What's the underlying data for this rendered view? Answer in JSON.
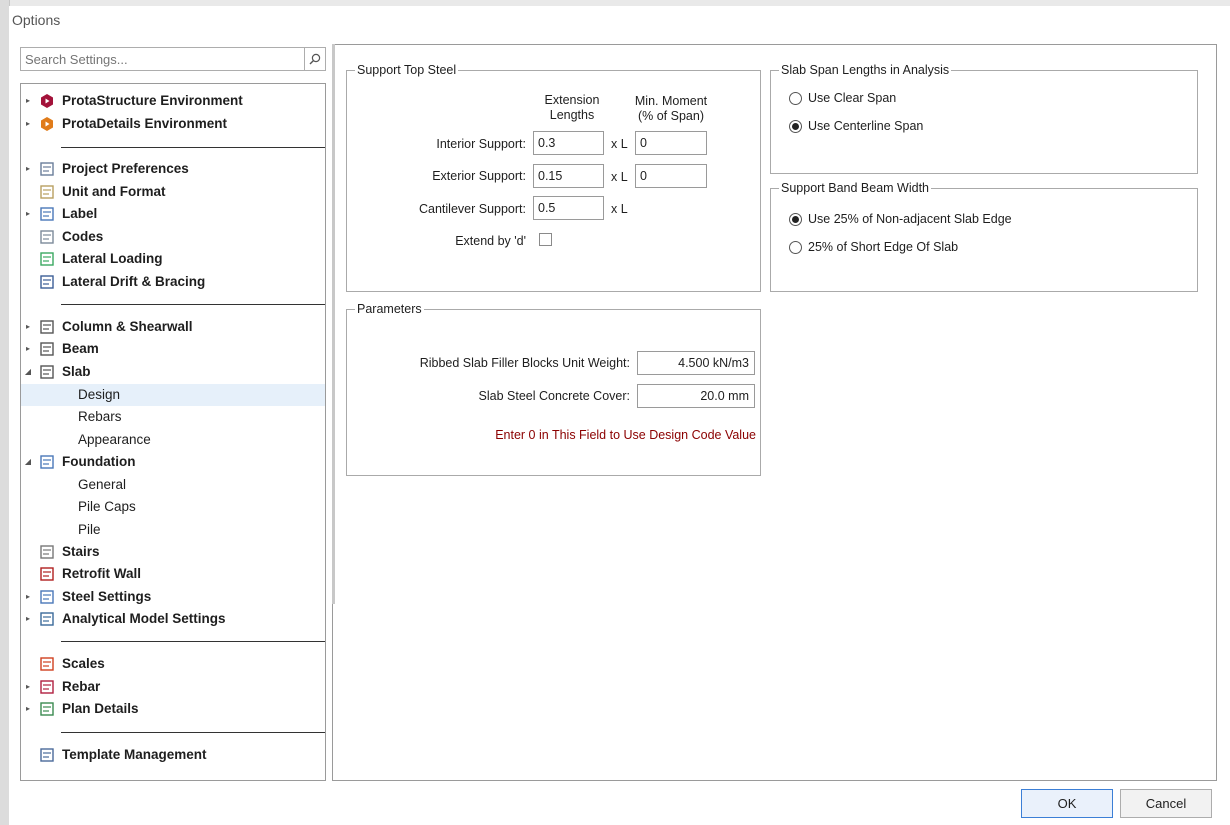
{
  "window": {
    "title": "Options"
  },
  "search": {
    "placeholder": "Search Settings..."
  },
  "tree": [
    {
      "label": "ProtaStructure Environment",
      "bold": true,
      "arrow": "▸",
      "icon": "protastructure-icon"
    },
    {
      "label": "ProtaDetails Environment",
      "bold": true,
      "arrow": "▸",
      "icon": "protadetails-icon"
    },
    {
      "label": "Project Preferences",
      "bold": true,
      "arrow": "▸",
      "icon": "preferences-icon"
    },
    {
      "label": "Unit and Format",
      "bold": true,
      "arrow": "",
      "icon": "unit-format-icon"
    },
    {
      "label": "Label",
      "bold": true,
      "arrow": "▸",
      "icon": "label-icon"
    },
    {
      "label": "Codes",
      "bold": true,
      "arrow": "",
      "icon": "codes-icon"
    },
    {
      "label": "Lateral Loading",
      "bold": true,
      "arrow": "",
      "icon": "lateral-loading-icon"
    },
    {
      "label": "Lateral Drift & Bracing",
      "bold": true,
      "arrow": "",
      "icon": "lateral-drift-icon"
    },
    {
      "label": "Column & Shearwall",
      "bold": true,
      "arrow": "▸",
      "icon": "column-icon"
    },
    {
      "label": "Beam",
      "bold": true,
      "arrow": "▸",
      "icon": "beam-icon"
    },
    {
      "label": "Slab",
      "bold": true,
      "arrow": "◢",
      "icon": "slab-icon"
    },
    {
      "label": "Design",
      "bold": false,
      "selected": true
    },
    {
      "label": "Rebars",
      "bold": false
    },
    {
      "label": "Appearance",
      "bold": false
    },
    {
      "label": "Foundation",
      "bold": true,
      "arrow": "◢",
      "icon": "foundation-icon"
    },
    {
      "label": "General",
      "bold": false
    },
    {
      "label": "Pile Caps",
      "bold": false
    },
    {
      "label": "Pile",
      "bold": false
    },
    {
      "label": "Stairs",
      "bold": true,
      "arrow": "",
      "icon": "stairs-icon"
    },
    {
      "label": "Retrofit Wall",
      "bold": true,
      "arrow": "",
      "icon": "retrofit-wall-icon"
    },
    {
      "label": "Steel Settings",
      "bold": true,
      "arrow": "▸",
      "icon": "steel-icon"
    },
    {
      "label": "Analytical Model Settings",
      "bold": true,
      "arrow": "▸",
      "icon": "analytical-model-icon"
    },
    {
      "label": "Scales",
      "bold": true,
      "arrow": "",
      "icon": "scales-icon"
    },
    {
      "label": "Rebar",
      "bold": true,
      "arrow": "▸",
      "icon": "rebar-icon"
    },
    {
      "label": "Plan Details",
      "bold": true,
      "arrow": "▸",
      "icon": "plan-details-icon"
    },
    {
      "label": "Template Management",
      "bold": true,
      "arrow": "",
      "icon": "template-icon"
    }
  ],
  "support_top_steel": {
    "legend": "Support Top Steel",
    "col1_header_line1": "Extension",
    "col1_header_line2": "Lengths",
    "col2_header_line1": "Min. Moment",
    "col2_header_line2": "(% of Span)",
    "rows": [
      {
        "label": "Interior Support:",
        "extension": "0.3",
        "unit": "x L",
        "min_moment": "0"
      },
      {
        "label": "Exterior Support:",
        "extension": "0.15",
        "unit": "x L",
        "min_moment": "0"
      },
      {
        "label": "Cantilever Support:",
        "extension": "0.5",
        "unit": "x L"
      }
    ],
    "extend_label": "Extend by 'd'",
    "extend_checked": false
  },
  "slab_span": {
    "legend": "Slab Span Lengths in Analysis",
    "options": [
      "Use Clear Span",
      "Use Centerline Span"
    ],
    "selected": "Use Centerline Span"
  },
  "band_beam": {
    "legend": "Support Band Beam Width",
    "options": [
      "Use 25% of Non-adjacent Slab Edge",
      "25% of Short Edge Of Slab"
    ],
    "selected": "Use 25% of Non-adjacent Slab Edge"
  },
  "parameters": {
    "legend": "Parameters",
    "filler_label": "Ribbed Slab Filler Blocks Unit Weight:",
    "filler_value": "4.500 kN/m3",
    "cover_label": "Slab Steel Concrete Cover:",
    "cover_value": "20.0 mm",
    "note": "Enter 0 in This Field to Use Design Code Value",
    "note_color": "#8b0000"
  },
  "buttons": {
    "ok": "OK",
    "cancel": "Cancel"
  }
}
